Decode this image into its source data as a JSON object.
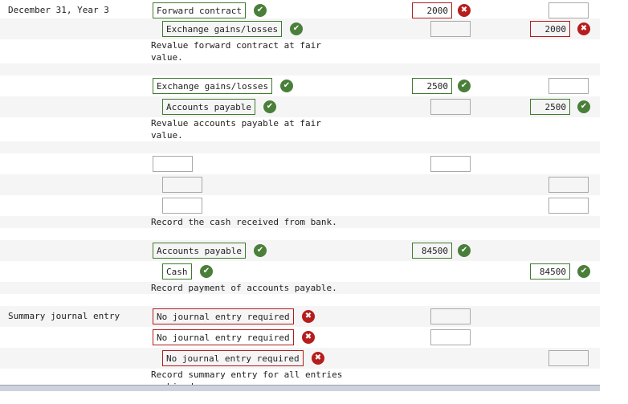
{
  "entries": [
    {
      "date": "December 31, Year 3",
      "lines": [
        {
          "account": "Forward contract",
          "account_status": "correct",
          "debit": "2000",
          "debit_status": "incorrect",
          "credit": "",
          "credit_status": "",
          "indent": false
        },
        {
          "account": "Exchange gains/losses",
          "account_status": "correct",
          "debit": "",
          "debit_status": "",
          "credit": "2000",
          "credit_status": "incorrect",
          "indent": true
        }
      ],
      "memo": "Revalue forward contract at fair value."
    },
    {
      "date": "",
      "lines": [
        {
          "account": "Exchange gains/losses",
          "account_status": "correct",
          "debit": "2500",
          "debit_status": "correct",
          "credit": "",
          "credit_status": "",
          "indent": false
        },
        {
          "account": "Accounts payable",
          "account_status": "correct",
          "debit": "",
          "debit_status": "",
          "credit": "2500",
          "credit_status": "correct",
          "indent": true
        }
      ],
      "memo": "Revalue accounts payable at fair value."
    },
    {
      "date": "",
      "lines": [
        {
          "account": "",
          "account_status": "",
          "debit": "",
          "debit_status": "",
          "credit": null,
          "credit_status": "",
          "indent": false
        },
        {
          "account": "",
          "account_status": "",
          "debit": null,
          "debit_status": "",
          "credit": "",
          "credit_status": "",
          "indent": true
        },
        {
          "account": "",
          "account_status": "",
          "debit": null,
          "debit_status": "",
          "credit": "",
          "credit_status": "",
          "indent": true
        }
      ],
      "memo": "Record the cash received from bank."
    },
    {
      "date": "",
      "lines": [
        {
          "account": "Accounts payable",
          "account_status": "correct",
          "debit": "84500",
          "debit_status": "correct",
          "credit": null,
          "credit_status": "",
          "indent": false
        },
        {
          "account": "Cash",
          "account_status": "correct",
          "debit": null,
          "debit_status": "",
          "credit": "84500",
          "credit_status": "correct",
          "indent": true
        }
      ],
      "memo": "Record payment of accounts payable."
    },
    {
      "date": "Summary journal entry",
      "lines": [
        {
          "account": "No journal entry required",
          "account_status": "incorrect",
          "debit": "",
          "debit_status": "",
          "credit": null,
          "credit_status": "",
          "indent": false
        },
        {
          "account": "No journal entry required",
          "account_status": "incorrect",
          "debit": "",
          "debit_status": "",
          "credit": null,
          "credit_status": "",
          "indent": false
        },
        {
          "account": "No journal entry required",
          "account_status": "incorrect",
          "debit": null,
          "debit_status": "",
          "credit": "",
          "credit_status": "",
          "indent": true
        }
      ],
      "memo": "Record summary entry for all entries combined."
    }
  ],
  "colors": {
    "correct": "#4a7f3a",
    "incorrect": "#b61d1d",
    "row_alt": "#f5f5f5"
  },
  "icons": {
    "correct": "check-circle-icon",
    "incorrect": "x-circle-icon"
  }
}
